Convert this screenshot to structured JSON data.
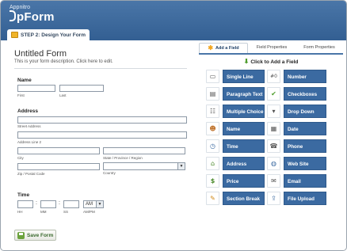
{
  "header": {
    "brand_top": "Appnitro",
    "brand": "pForm",
    "step_tab": "STEP 2: Design Your Form"
  },
  "form": {
    "title": "Untitled Form",
    "description": "This is your form description. Click here to edit.",
    "name": {
      "label": "Name",
      "first": "First",
      "last": "Last"
    },
    "address": {
      "label": "Address",
      "street": "Street Address",
      "line2": "Address Line 2",
      "city": "City",
      "state": "State / Province / Region",
      "zip": "Zip / Postal Code",
      "country": "Country"
    },
    "time": {
      "label": "Time",
      "hh": "HH",
      "mm": "MM",
      "ss": "SS",
      "ampm_value": "AM",
      "ampm": "AM/PM"
    },
    "save_label": "Save Form"
  },
  "panel": {
    "tabs": [
      "Add a Field",
      "Field Properties",
      "Form Properties"
    ],
    "click_to_add": "Click to Add a Field",
    "fields_left": [
      {
        "label": "Single Line Text",
        "icon": "text-field-icon"
      },
      {
        "label": "Paragraph Text",
        "icon": "paragraph-icon"
      },
      {
        "label": "Multiple Choice",
        "icon": "multiple-choice-icon"
      },
      {
        "label": "Name",
        "icon": "person-icon"
      },
      {
        "label": "Time",
        "icon": "clock-icon"
      },
      {
        "label": "Address",
        "icon": "house-icon"
      },
      {
        "label": "Price",
        "icon": "dollar-icon"
      },
      {
        "label": "Section Break",
        "icon": "pencil-icon"
      }
    ],
    "fields_right": [
      {
        "label": "Number",
        "icon": "number-icon"
      },
      {
        "label": "Checkboxes",
        "icon": "checkmark-icon"
      },
      {
        "label": "Drop Down",
        "icon": "dropdown-icon"
      },
      {
        "label": "Date",
        "icon": "calendar-icon"
      },
      {
        "label": "Phone",
        "icon": "phone-icon"
      },
      {
        "label": "Web Site",
        "icon": "globe-icon"
      },
      {
        "label": "Email",
        "icon": "envelope-icon"
      },
      {
        "label": "File Upload",
        "icon": "upload-icon"
      }
    ]
  },
  "colors": {
    "header": "#3d6a9c",
    "field_button": "#3b6aa1",
    "save_text": "#3a6a2e"
  }
}
